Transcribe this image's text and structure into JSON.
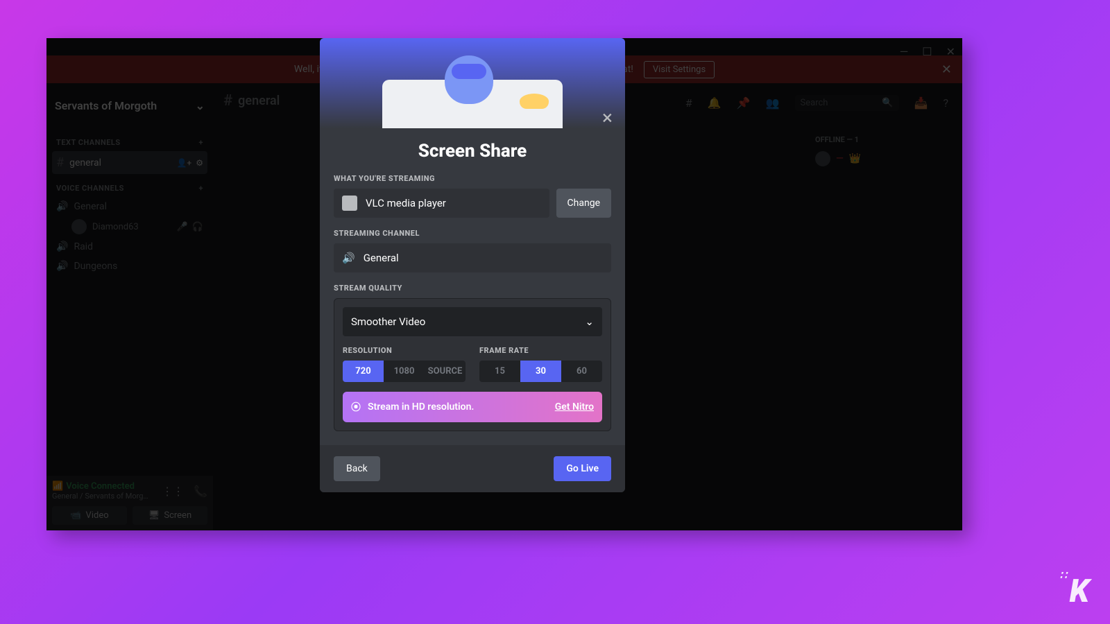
{
  "warning_banner": {
    "text": "Well, it looks like Discord is not detecting any input from your mic. Let's fix that!",
    "button": "Visit Settings"
  },
  "titlebar": {
    "minimize": "—",
    "maximize": "☐",
    "close": "✕"
  },
  "guild": {
    "name": "Servants of Morgoth",
    "current_channel": "general"
  },
  "sidebar": {
    "text_channels_label": "TEXT CHANNELS",
    "voice_channels_label": "VOICE CHANNELS",
    "text_channels": [
      {
        "name": "general",
        "active": true
      }
    ],
    "voice_channels": [
      {
        "name": "General",
        "users": [
          {
            "name": "Diamond63"
          }
        ]
      },
      {
        "name": "Raid"
      },
      {
        "name": "Dungeons"
      }
    ]
  },
  "voice_panel": {
    "status": "Voice Connected",
    "sub": "General / Servants of Morg…",
    "video_btn": "Video",
    "screen_btn": "Screen"
  },
  "topbar": {
    "search_placeholder": "Search"
  },
  "memberlist": {
    "offline_label": "OFFLINE — 1",
    "members": [
      {
        "name": "—"
      }
    ]
  },
  "modal": {
    "title": "Screen Share",
    "what_streaming_label": "WHAT YOU'RE STREAMING",
    "streaming_source": "VLC media player",
    "change_btn": "Change",
    "channel_label": "STREAMING CHANNEL",
    "channel_name": "General",
    "quality_label": "STREAM QUALITY",
    "quality_preset": "Smoother Video",
    "resolution_label": "RESOLUTION",
    "resolutions": [
      "720",
      "1080",
      "SOURCE"
    ],
    "resolution_selected": "720",
    "framerate_label": "FRAME RATE",
    "framerates": [
      "15",
      "30",
      "60"
    ],
    "framerate_selected": "30",
    "nitro_text": "Stream in HD resolution.",
    "nitro_link": "Get Nitro",
    "back_btn": "Back",
    "golive_btn": "Go Live"
  }
}
